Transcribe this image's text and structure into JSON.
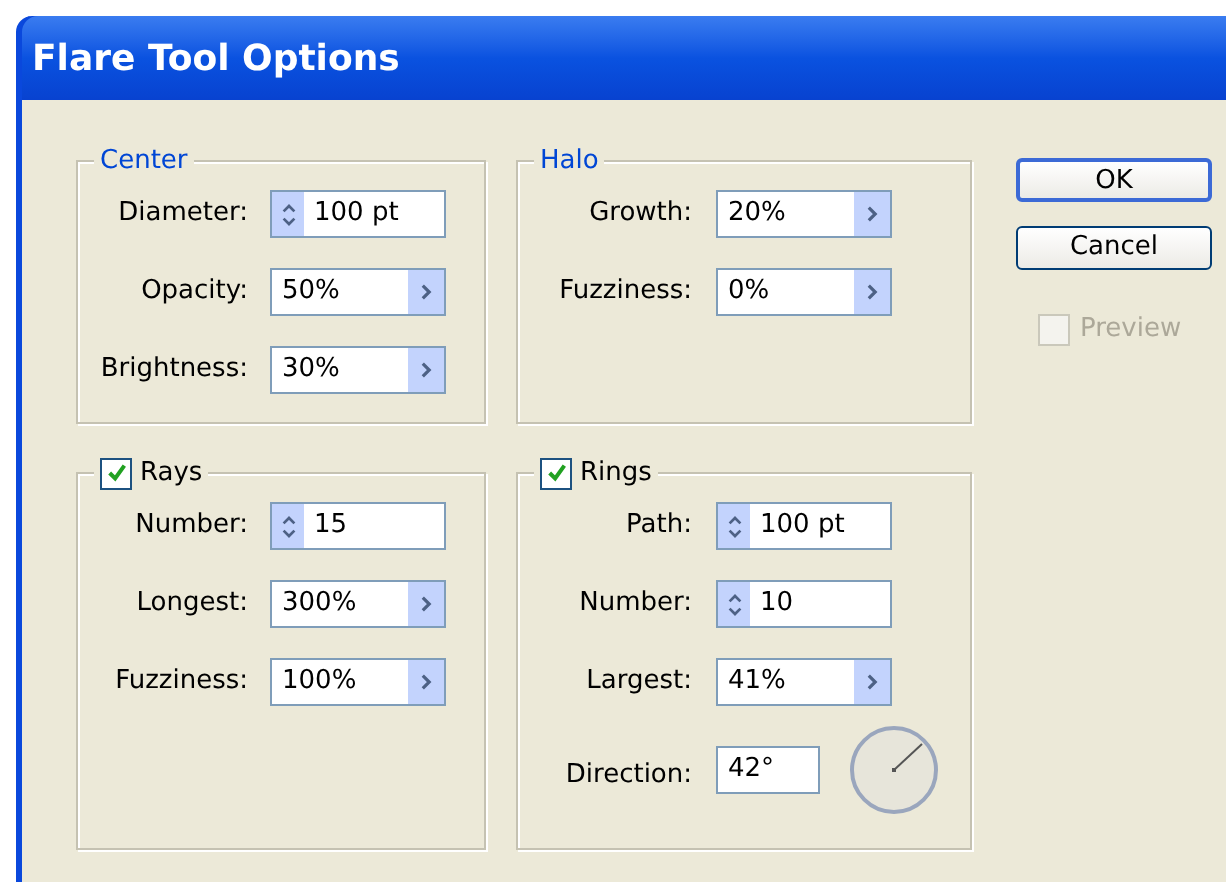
{
  "window": {
    "title": "Flare Tool Options"
  },
  "groups": [
    {
      "legend": "Center",
      "kind": "titled",
      "fields": [
        {
          "label": "Diameter:",
          "value": "100 pt",
          "kind": "stepper"
        },
        {
          "label": "Opacity:",
          "value": "50%",
          "kind": "popup"
        },
        {
          "label": "Brightness:",
          "value": "30%",
          "kind": "popup"
        }
      ]
    },
    {
      "legend": "Halo",
      "kind": "titled",
      "fields": [
        {
          "label": "Growth:",
          "value": "20%",
          "kind": "popup"
        },
        {
          "label": "Fuzziness:",
          "value": "0%",
          "kind": "popup"
        }
      ]
    },
    {
      "legend": "Rays",
      "kind": "checkable",
      "checked": true,
      "fields": [
        {
          "label": "Number:",
          "value": "15",
          "kind": "stepper"
        },
        {
          "label": "Longest:",
          "value": "300%",
          "kind": "popup"
        },
        {
          "label": "Fuzziness:",
          "value": "100%",
          "kind": "popup"
        }
      ]
    },
    {
      "legend": "Rings",
      "kind": "checkable",
      "checked": true,
      "fields": [
        {
          "label": "Path:",
          "value": "100 pt",
          "kind": "stepper"
        },
        {
          "label": "Number:",
          "value": "10",
          "kind": "stepper"
        },
        {
          "label": "Largest:",
          "value": "41%",
          "kind": "popup"
        },
        {
          "label": "Direction:",
          "value": "42°",
          "kind": "angle"
        }
      ]
    }
  ],
  "buttons": [
    {
      "label": "OK",
      "default": true
    },
    {
      "label": "Cancel",
      "default": false
    }
  ],
  "preview": {
    "label": "Preview",
    "checked": false,
    "disabled": true
  }
}
